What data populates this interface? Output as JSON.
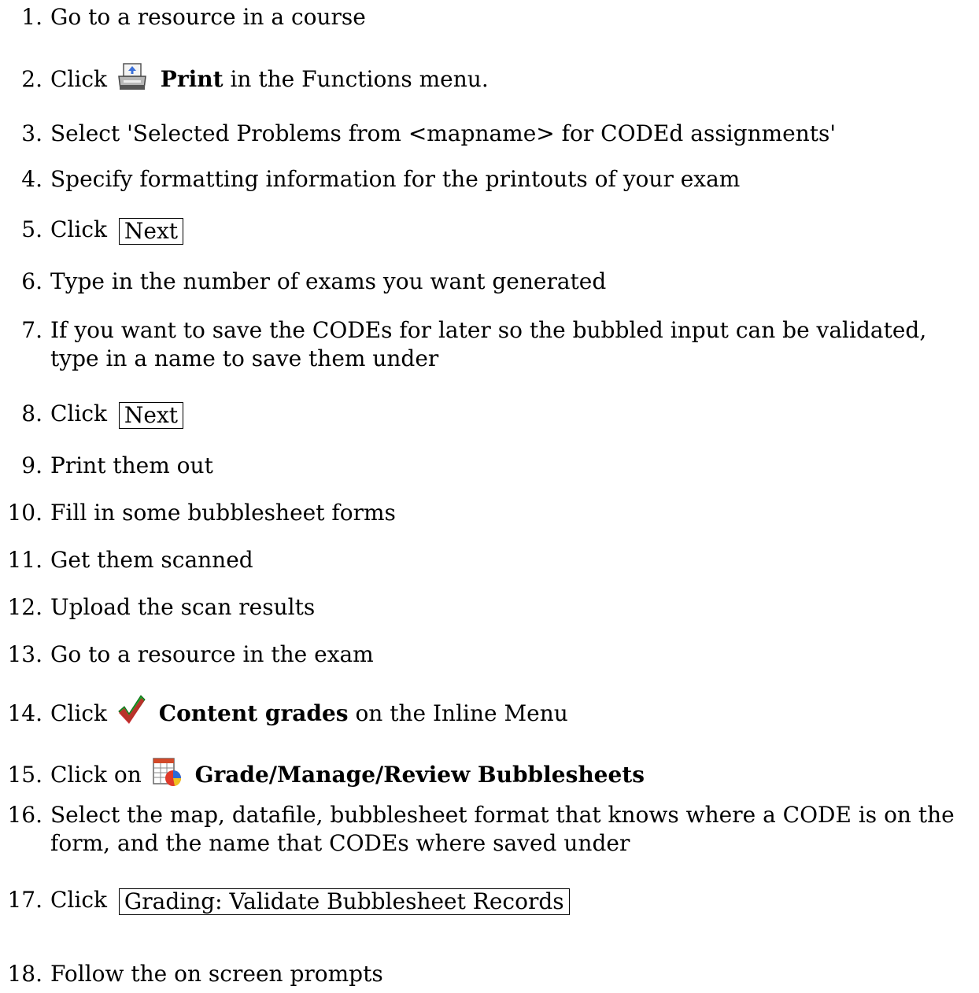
{
  "steps": [
    {
      "n": "1.",
      "text": "Go to a resource in a course"
    },
    {
      "n": "2.",
      "pre": "Click",
      "icon": "printer-icon",
      "bold": "Print",
      "post": "in the Functions menu."
    },
    {
      "n": "3.",
      "text": "Select 'Selected Problems from <mapname> for CODEd assignments'"
    },
    {
      "n": "4.",
      "text": "Specify formatting information for the printouts of your exam"
    },
    {
      "n": "5.",
      "pre": "Click",
      "button": "Next"
    },
    {
      "n": "6.",
      "text": "Type in the number of exams you want generated"
    },
    {
      "n": "7.",
      "text": "If you want to save the CODEs for later so the bubbled input can be validated, type in a name to save them under"
    },
    {
      "n": "8.",
      "pre": "Click",
      "button": "Next"
    },
    {
      "n": "9.",
      "text": "Print them out"
    },
    {
      "n": "10.",
      "text": "Fill in some bubblesheet forms"
    },
    {
      "n": "11.",
      "text": "Get them scanned"
    },
    {
      "n": "12.",
      "text": "Upload the scan results"
    },
    {
      "n": "13.",
      "text": "Go to a resource in the exam"
    },
    {
      "n": "14.",
      "pre": "Click",
      "icon": "checkmark-icon",
      "bold": "Content grades",
      "post": "on the Inline Menu"
    },
    {
      "n": "15.",
      "pre": "Click on",
      "icon": "spreadsheet-chart-icon",
      "bold": "Grade/Manage/Review Bubblesheets"
    },
    {
      "n": "16.",
      "text": "Select the map, datafile, bubblesheet format that knows where a CODE is on the form, and the name that CODEs where saved under"
    },
    {
      "n": "17.",
      "pre": "Click",
      "button": "Grading: Validate Bubblesheet Records"
    },
    {
      "n": "18.",
      "text": "Follow the on screen prompts"
    }
  ]
}
